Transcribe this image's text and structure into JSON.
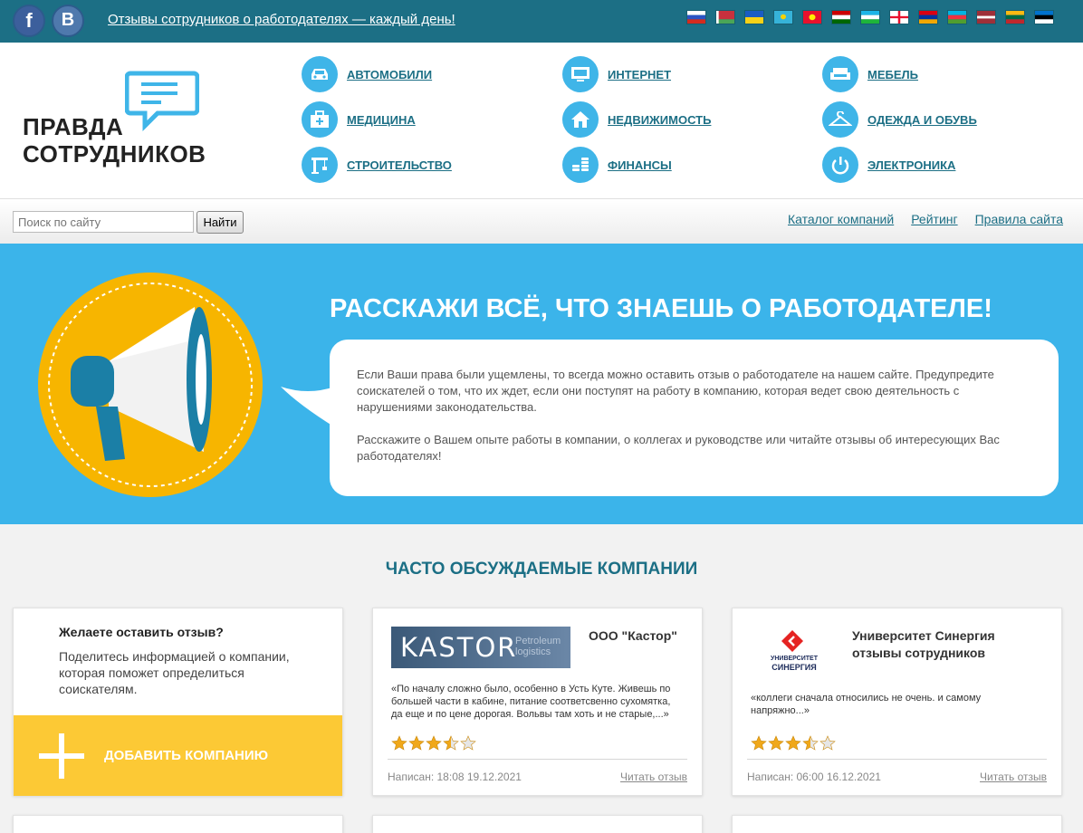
{
  "topbar": {
    "facebook_label": "f",
    "vk_label": "B",
    "tagline": "Отзывы сотрудников о работодателях — каждый день!",
    "flags": [
      "ru",
      "by",
      "ua",
      "kz",
      "kg",
      "tj",
      "uz",
      "ge",
      "am",
      "az",
      "lv",
      "lt",
      "ee"
    ]
  },
  "logo": {
    "line1": "ПРАВДА",
    "line2": "СОТРУДНИКОВ"
  },
  "categories": [
    {
      "label": "Автомобили",
      "icon": "car-icon"
    },
    {
      "label": "Интернет",
      "icon": "monitor-icon"
    },
    {
      "label": "Мебель",
      "icon": "sofa-icon"
    },
    {
      "label": "Медицина",
      "icon": "medkit-icon"
    },
    {
      "label": "Недвижимость",
      "icon": "house-icon"
    },
    {
      "label": "Одежда и обувь",
      "icon": "hanger-icon"
    },
    {
      "label": "Строительство",
      "icon": "crane-icon"
    },
    {
      "label": "Финансы",
      "icon": "coins-icon"
    },
    {
      "label": "Электроника",
      "icon": "power-icon"
    }
  ],
  "search": {
    "placeholder": "Поиск по сайту",
    "button": "Найти"
  },
  "nav": {
    "catalog": "Каталог компаний",
    "rating": "Рейтинг",
    "rules": "Правила сайта"
  },
  "hero": {
    "title": "РАССКАЖИ ВСЁ, ЧТО ЗНАЕШЬ О РАБОТОДАТЕЛЕ!",
    "p1": "Если Ваши права были ущемлены, то всегда можно оставить отзыв о работодателе на нашем сайте. Предупредите соискателей о том, что их ждет, если они поступят на работу в компанию, которая ведет свою деятельность с нарушениями законодательства.",
    "p2": "Расскажите о Вашем опыте работы в компании, о коллегах и руководстве или читайте отзывы об интересующих Вас работодателях!"
  },
  "section": {
    "title": "ЧАСТО ОБСУЖДАЕМЫЕ КОМПАНИИ"
  },
  "add_card": {
    "question": "Желаете оставить отзыв?",
    "description": "Поделитесь информацией о компании, которая поможет определиться соискателям.",
    "button": "Добавить компанию"
  },
  "companies": [
    {
      "name": "ООО \"Кастор\"",
      "logo_main": "KASTOR",
      "logo_sub1": "Petroleum",
      "logo_sub2": "logistics",
      "review": "«По началу сложно было, особенно в Усть Куте. Живешь по большей части в кабине, питание соответсвенно сухомятка, да еще и по цене дорогая. Вольвы там хоть и не старые,...»",
      "rating": 3.5,
      "written": "Написан: 18:08 19.12.2021",
      "read": "Читать отзыв"
    },
    {
      "name": "Университет Синергия отзывы сотрудников",
      "logo_line1": "УНИВЕРСИТЕТ",
      "logo_line2": "СИНЕРГИЯ",
      "review": "«коллеги сначала относились не очень. и самому напряжно...»",
      "rating": 3.5,
      "written": "Написан: 06:00 16.12.2021",
      "read": "Читать отзыв"
    }
  ],
  "colors": {
    "topbar": "#1c6f85",
    "hero": "#3bb4ea",
    "accent_yellow": "#fcc935",
    "category_icon": "#3fb5e8"
  }
}
